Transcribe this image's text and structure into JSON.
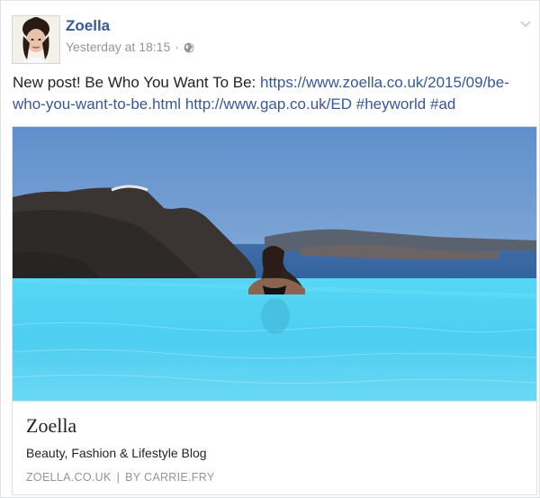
{
  "post": {
    "author": "Zoella",
    "timestamp": "Yesterday at 18:15",
    "separator": "·",
    "privacy_icon": "globe-icon",
    "menu_icon": "chevron-down-icon",
    "message": {
      "text": "New post! Be Who You Want To Be: ",
      "link1": "https://www.zoella.co.uk/2015/09/be-who-you-want-to-be.html",
      "link2": "http://www.gap.co.uk/ED",
      "hashtag1": "#heyworld",
      "hashtag2": "#ad"
    },
    "attachment": {
      "title": "Zoella",
      "description": "Beauty, Fashion & Lifestyle Blog",
      "domain": "ZOELLA.CO.UK",
      "divider": "|",
      "byline": "BY CARRIE.FRY"
    }
  },
  "colors": {
    "link": "#365899",
    "meta": "#90949c",
    "pool": "#4fd0f2",
    "sky": "#6f9ad0"
  }
}
